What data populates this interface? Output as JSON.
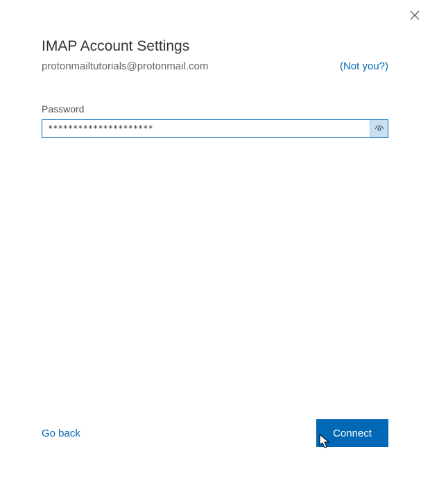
{
  "header": {
    "title": "IMAP Account Settings",
    "email": "protonmailtutorials@protonmail.com",
    "not_you_label": "(Not you?)"
  },
  "form": {
    "password_label": "Password",
    "password_value": "*********************"
  },
  "footer": {
    "go_back_label": "Go back",
    "connect_label": "Connect"
  }
}
